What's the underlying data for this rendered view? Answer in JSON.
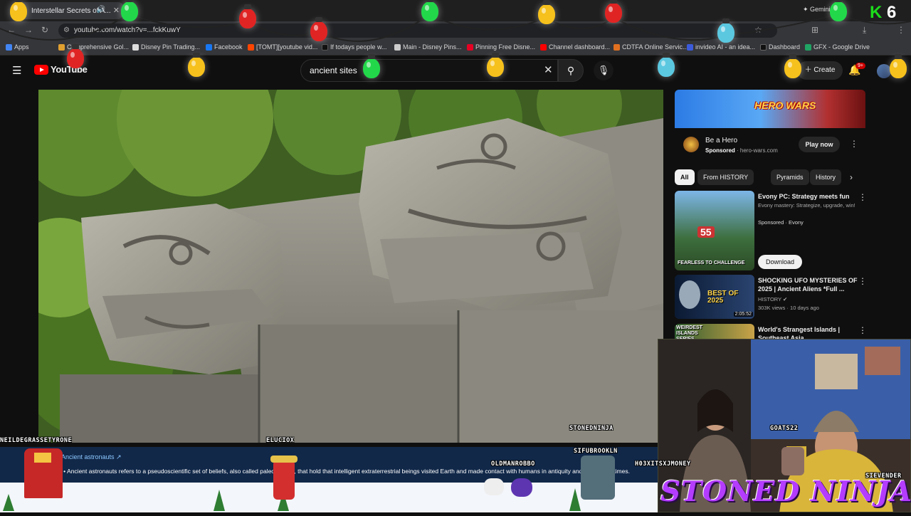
{
  "browser": {
    "tab_title": "Interstellar Secrets of A...",
    "url": "youtube.com/watch?v=...fckKuwY",
    "gemini_label": "Gemini",
    "bookmarks": [
      {
        "label": "Apps",
        "color": "#4285f4"
      },
      {
        "label": "Comprehensive Gol...",
        "color": "#e0a030"
      },
      {
        "label": "Disney Pin Trading...",
        "color": "#dddddd"
      },
      {
        "label": "Facebook",
        "color": "#1877f2"
      },
      {
        "label": "[TOMT][youtube vid...",
        "color": "#ff4500"
      },
      {
        "label": "If todays people w...",
        "color": "#111111"
      },
      {
        "label": "Main - Disney Pins...",
        "color": "#cccccc"
      },
      {
        "label": "Pinning Free Disne...",
        "color": "#e60023"
      },
      {
        "label": "Channel dashboard...",
        "color": "#ff0000"
      },
      {
        "label": "CDTFA Online Servic...",
        "color": "#e07020"
      },
      {
        "label": "invideo AI - an idea...",
        "color": "#3b5bdb"
      },
      {
        "label": "Dashboard",
        "color": "#111111"
      },
      {
        "label": "GFX - Google Drive",
        "color": "#1fa463"
      }
    ]
  },
  "youtube": {
    "logo_text": "YouTube",
    "search_query": "ancient sites",
    "create_label": "Create",
    "notification_badge": "9+"
  },
  "ad": {
    "banner_text": "HERO WARS",
    "title": "Be a Hero",
    "sponsored": "Sponsored",
    "domain": "hero-wars.com",
    "cta": "Play now"
  },
  "chips": [
    "All",
    "From HISTORY",
    "Pyramids",
    "History"
  ],
  "recommendations": [
    {
      "title": "Evony PC: Strategy meets fun",
      "meta1": "Evony mastery: Strategize, upgrade, win!",
      "meta2": "Sponsored · Evony",
      "thumb_text": "FEARLESS TO CHALLENGE",
      "thumb_num": "55",
      "cta": "Download"
    },
    {
      "title": "SHOCKING UFO MYSTERIES OF 2025 | Ancient Aliens *Full ...",
      "channel": "HISTORY",
      "stats": "303K views · 10 days ago",
      "thumb_text": "BEST OF 2025",
      "duration": "2:05:52"
    },
    {
      "title": "World's Strangest Islands | Southeast Asia",
      "thumb_text": "WEIRDEST ISLANDS SERIES"
    }
  ],
  "stream": {
    "ticker_link": "Ancient astronauts ↗",
    "ticker_text": "pedia • Ancient astronauts refers to a pseudoscientific set of beliefs, also called paleocontact, that hold that intelligent extraterrestrial beings visited Earth and made contact with humans in antiquity and prehistoric times.",
    "brand": "STONED NINJA",
    "handles": {
      "h1": "NEILDEGRASSETYRONE",
      "h2": "ELUCIOX",
      "h3": "STONEDNINJA",
      "h4": "OLDMANROBBO",
      "h5": "SIFUBROOKLN",
      "h6": "H03XITSXJMONEY",
      "h7": "GOATS22",
      "h8": "SIEVENDER"
    },
    "overlay_badge": "6"
  }
}
